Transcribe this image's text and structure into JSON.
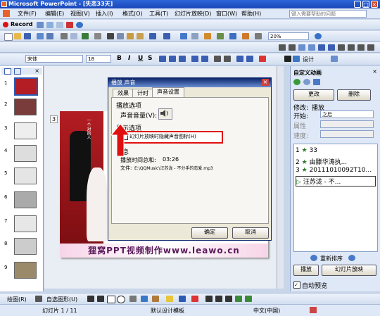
{
  "title": "Microsoft PowerPoint - [失恋33天]",
  "menu": [
    "文件(F)",
    "编辑(E)",
    "视图(V)",
    "插入(I)",
    "格式(O)",
    "工具(T)",
    "幻灯片放映(D)",
    "窗口(W)",
    "帮助(H)"
  ],
  "help_placeholder": "键入需要帮助的问题",
  "record_label": "Record",
  "font_name": "宋体",
  "font_size": "18",
  "zoom": "20%",
  "format_labels": {
    "bold": "B",
    "italic": "I",
    "underline": "U",
    "shadow": "S"
  },
  "slide_numbers": [
    "1",
    "2",
    "3",
    "4",
    "5",
    "6",
    "7",
    "8",
    "9"
  ],
  "slide_editor_number": "3",
  "slide_banner": "狸窝PPT视频制作www.leawo.cn",
  "photo_caption": "一个对的人",
  "dialog": {
    "title": "播放 声音",
    "tabs": [
      "效果",
      "计时",
      "声音设置"
    ],
    "play_options": "播放选项",
    "volume_label": "声音音量(V):",
    "display_options": "显示选项",
    "hide_icon_label": "幻灯片放映时隐藏声音图标(H)",
    "info_label": "信息",
    "duration_label": "播放时间总和:",
    "duration_value": "03:26",
    "file_label": "文件:",
    "file_value": "E:\\QQMusic\\汪苏泷 - 不分手的恋爱.mp3",
    "ok": "确定",
    "cancel": "取消"
  },
  "task_pane": {
    "title": "自定义动画",
    "change": "更改",
    "delete": "删除",
    "modify_label": "修改:",
    "modify_value": "播放",
    "start_label": "开始:",
    "start_value": "之后",
    "property_label": "属性",
    "speed_label": "速度:",
    "items": [
      {
        "num": "1",
        "text": "33"
      },
      {
        "num": "2",
        "text": "由滕华涛执..."
      },
      {
        "num": "3",
        "text": "20111010092T10..."
      },
      {
        "num": "",
        "text": "汪苏泷 - 不..."
      }
    ],
    "reorder": "重新排序",
    "play": "播放",
    "slideshow": "幻灯片放映",
    "autopreview": "自动预览"
  },
  "drawing": {
    "draw": "绘图(R)",
    "autoshapes": "自选图形(U)"
  },
  "status": {
    "slide": "幻灯片 1 / 11",
    "template": "默认设计模板",
    "language": "中文(中国)"
  }
}
